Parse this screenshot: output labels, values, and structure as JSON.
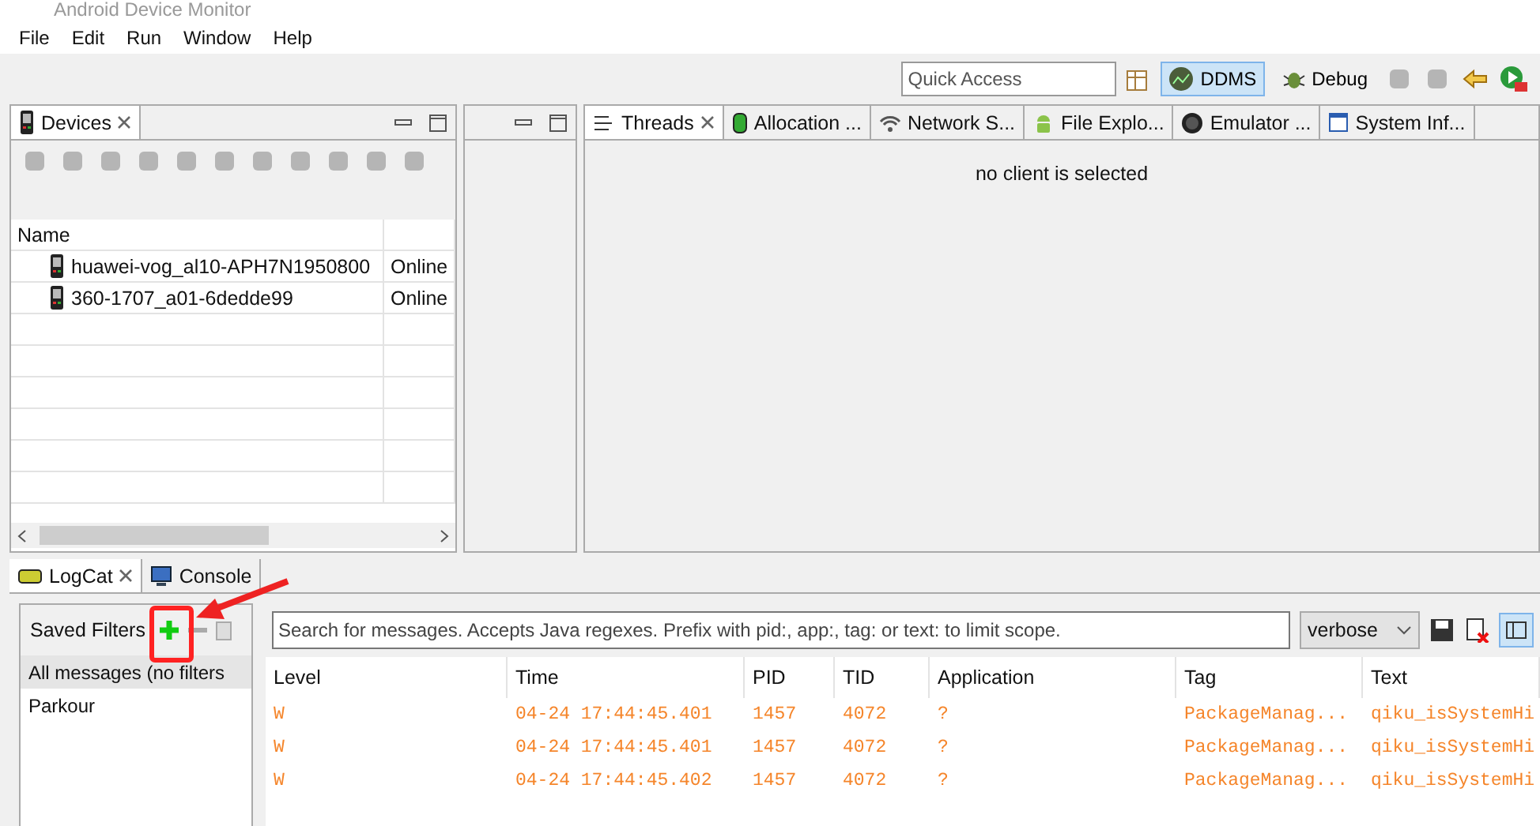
{
  "window": {
    "title": "Android Device Monitor"
  },
  "menu": [
    "File",
    "Edit",
    "Run",
    "Window",
    "Help"
  ],
  "toolbar": {
    "quick_access": {
      "placeholder": "Quick Access"
    },
    "perspectives": [
      {
        "label": "DDMS",
        "selected": true
      },
      {
        "label": "Debug",
        "selected": false
      }
    ]
  },
  "devices_panel": {
    "tab": "Devices",
    "columns": [
      "Name"
    ],
    "rows": [
      {
        "name": "huawei-vog_al10-APH7N1950800",
        "status": "Online"
      },
      {
        "name": "360-1707_a01-6dedde99",
        "status": "Online"
      }
    ]
  },
  "detail_panel": {
    "tabs": [
      {
        "label": "Threads",
        "selected": true
      },
      {
        "label": "Allocation ...",
        "selected": false
      },
      {
        "label": "Network S...",
        "selected": false
      },
      {
        "label": "File Explo...",
        "selected": false
      },
      {
        "label": "Emulator ...",
        "selected": false
      },
      {
        "label": "System Inf...",
        "selected": false
      }
    ],
    "message": "no client is selected"
  },
  "bottom_panel": {
    "tabs": [
      {
        "label": "LogCat",
        "selected": true
      },
      {
        "label": "Console",
        "selected": false
      }
    ],
    "saved_filters": {
      "title": "Saved Filters",
      "items": [
        {
          "label": "All messages (no filters",
          "selected": true
        },
        {
          "label": "Parkour",
          "selected": false
        }
      ]
    },
    "search": {
      "placeholder": "Search for messages. Accepts Java regexes. Prefix with pid:, app:, tag: or text: to limit scope."
    },
    "level_select": "verbose",
    "layout_toggle": {
      "selected": true
    },
    "log_table": {
      "columns": [
        "Level",
        "Time",
        "PID",
        "TID",
        "Application",
        "Tag",
        "Text"
      ],
      "rows": [
        [
          "W",
          "04-24 17:44:45.401",
          "1457",
          "4072",
          "?",
          "PackageManag...",
          "qiku_isSystemHi"
        ],
        [
          "W",
          "04-24 17:44:45.401",
          "1457",
          "4072",
          "?",
          "PackageManag...",
          "qiku_isSystemHi"
        ],
        [
          "W",
          "04-24 17:44:45.402",
          "1457",
          "4072",
          "?",
          "PackageManag...",
          "qiku_isSystemHi"
        ]
      ]
    }
  }
}
